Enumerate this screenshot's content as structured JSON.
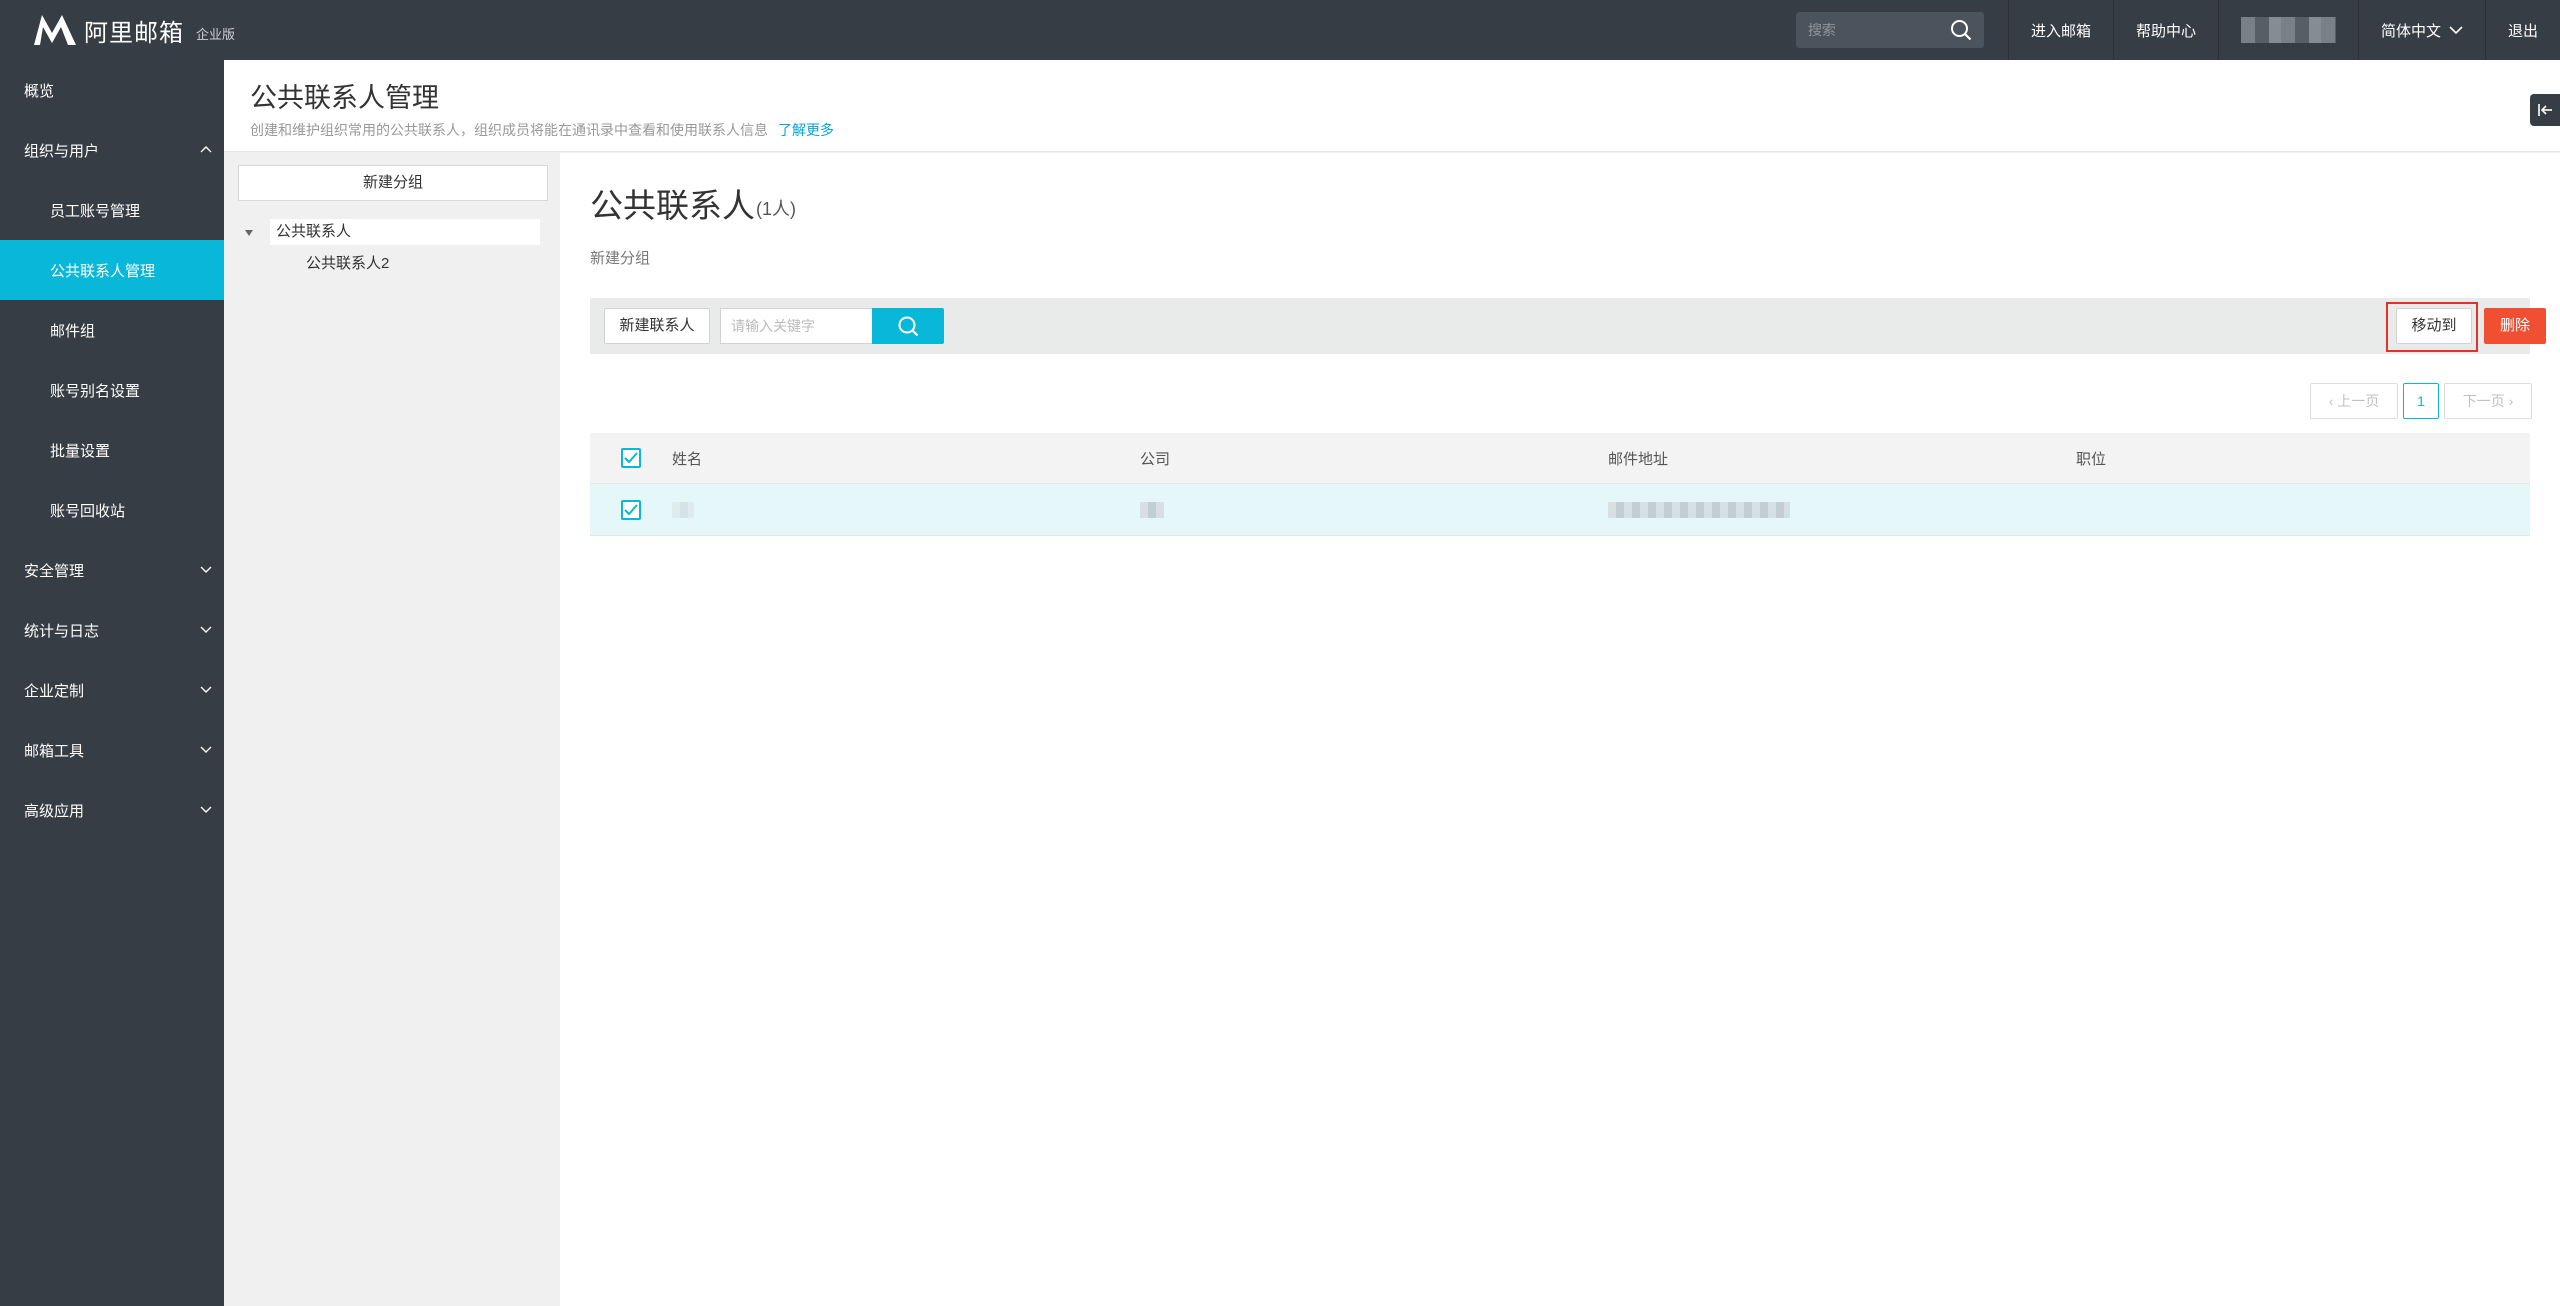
{
  "brand": {
    "name": "阿里邮箱",
    "edition": "企业版"
  },
  "topbar": {
    "search_placeholder": "搜索",
    "enter_mail": "进入邮箱",
    "help_center": "帮助中心",
    "language": "简体中文",
    "logout": "退出"
  },
  "sidebar": {
    "items": [
      {
        "label": "概览",
        "level": 1,
        "expanded": null
      },
      {
        "label": "组织与用户",
        "level": 1,
        "expanded": true
      },
      {
        "label": "员工账号管理",
        "level": 2
      },
      {
        "label": "公共联系人管理",
        "level": 2,
        "active": true
      },
      {
        "label": "邮件组",
        "level": 2
      },
      {
        "label": "账号别名设置",
        "level": 2
      },
      {
        "label": "批量设置",
        "level": 2
      },
      {
        "label": "账号回收站",
        "level": 2
      },
      {
        "label": "安全管理",
        "level": 1,
        "expanded": false
      },
      {
        "label": "统计与日志",
        "level": 1,
        "expanded": false
      },
      {
        "label": "企业定制",
        "level": 1,
        "expanded": false
      },
      {
        "label": "邮箱工具",
        "level": 1,
        "expanded": false
      },
      {
        "label": "高级应用",
        "level": 1,
        "expanded": false
      }
    ]
  },
  "header": {
    "title": "公共联系人管理",
    "description": "创建和维护组织常用的公共联系人，组织成员将能在通讯录中查看和使用联系人信息",
    "learn_more": "了解更多"
  },
  "groups": {
    "new_group_button": "新建分组",
    "tree": {
      "root": "公共联系人",
      "children": [
        "公共联系人2"
      ]
    }
  },
  "content": {
    "title": "公共联系人",
    "count": "(1人)",
    "new_group_link": "新建分组",
    "toolbar": {
      "new_contact": "新建联系人",
      "keyword_placeholder": "请输入关键字",
      "move_to": "移动到",
      "delete": "删除"
    },
    "pager": {
      "prev": "‹ 上一页",
      "current": "1",
      "next": "下一页 ›"
    },
    "table": {
      "columns": [
        "姓名",
        "公司",
        "邮件地址",
        "职位"
      ],
      "rows": [
        {
          "checked": true,
          "name": "",
          "company": "",
          "email": "",
          "title": ""
        }
      ]
    }
  },
  "colors": {
    "accent": "#09b7d9",
    "sidebar_bg": "#363d45",
    "danger": "#f04f32",
    "highlight": "#e4312b"
  }
}
